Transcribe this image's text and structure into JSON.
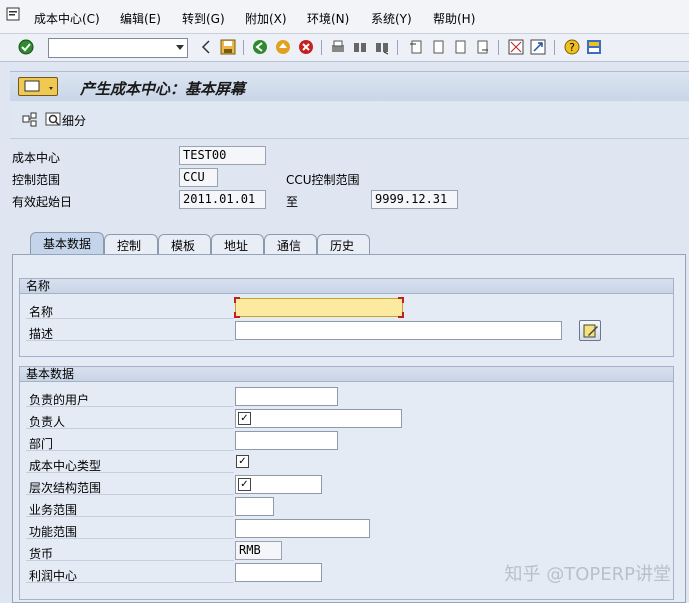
{
  "menu": {
    "items": [
      "成本中心(C)",
      "编辑(E)",
      "转到(G)",
      "附加(X)",
      "环境(N)",
      "系统(Y)",
      "帮助(H)"
    ]
  },
  "toolbar": {
    "command_field": ""
  },
  "title": "产生成本中心：基本屏幕",
  "app_toolbar": {
    "detail_label": "细分"
  },
  "header": {
    "cost_center_label": "成本中心",
    "cost_center_value": "TEST00",
    "controlling_area_label": "控制范围",
    "controlling_area_value": "CCU",
    "controlling_area_desc": "CCU控制范围",
    "valid_from_label": "有效起始日",
    "valid_from_value": "2011.01.01",
    "to_label": "至",
    "valid_to_value": "9999.12.31"
  },
  "tabs": [
    "基本数据",
    "控制",
    "模板",
    "地址",
    "通信",
    "历史"
  ],
  "names_group": {
    "title": "名称",
    "name_label": "名称",
    "desc_label": "描述"
  },
  "basic_group": {
    "title": "基本数据",
    "fields": [
      {
        "label": "负责的用户"
      },
      {
        "label": "负责人"
      },
      {
        "label": "部门"
      },
      {
        "label": "成本中心类型"
      },
      {
        "label": "层次结构范围"
      },
      {
        "label": "业务范围"
      },
      {
        "label": "功能范围"
      },
      {
        "label": "货币",
        "value": "RMB"
      },
      {
        "label": "利润中心"
      }
    ]
  },
  "watermark": "知乎 @TOPERP讲堂"
}
